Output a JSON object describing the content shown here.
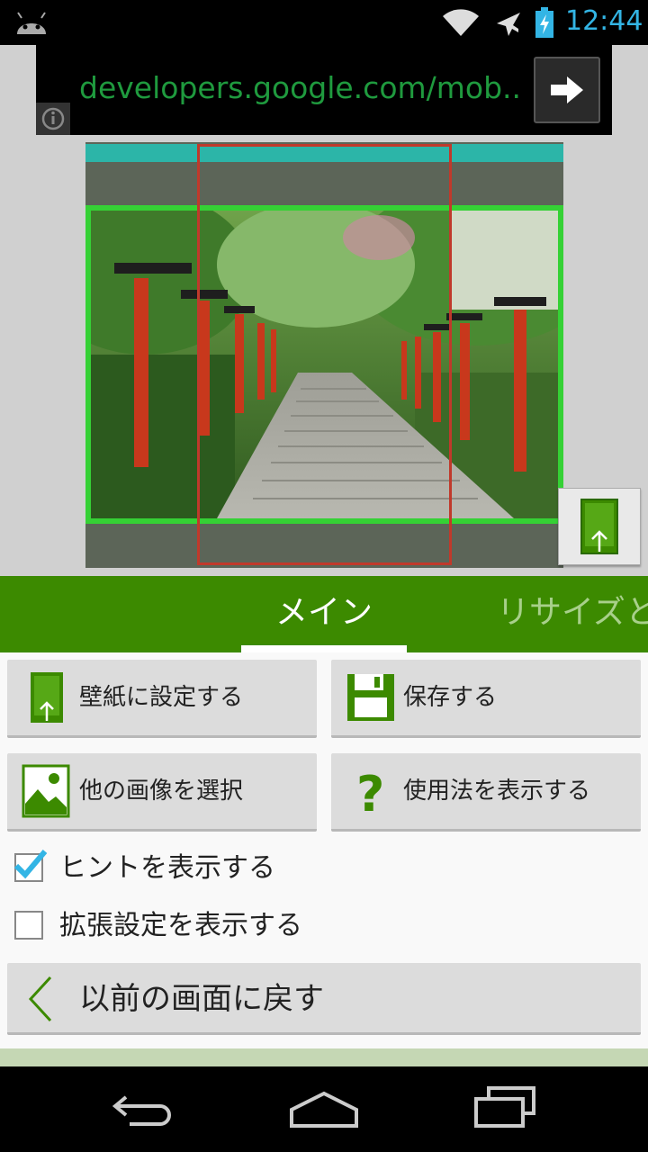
{
  "status_bar": {
    "time": "12:44"
  },
  "browser": {
    "url": "developers.google.com/mob..."
  },
  "tabs": [
    {
      "label": "メイン",
      "selected": true
    },
    {
      "label": "リサイズと",
      "selected": false
    }
  ],
  "buttons": {
    "set_wallpaper": "壁紙に設定する",
    "save": "保存する",
    "select_image": "他の画像を選択",
    "show_usage": "使用法を表示する",
    "back": "以前の画面に戻す"
  },
  "checkboxes": [
    {
      "label": "ヒントを表示する",
      "checked": true
    },
    {
      "label": "拡張設定を表示する",
      "checked": false
    }
  ],
  "colors": {
    "accent_green": "#3c8a00",
    "status_blue": "#33b5e5",
    "url_green": "#1f9a3e",
    "crop_red": "#c0392b"
  }
}
